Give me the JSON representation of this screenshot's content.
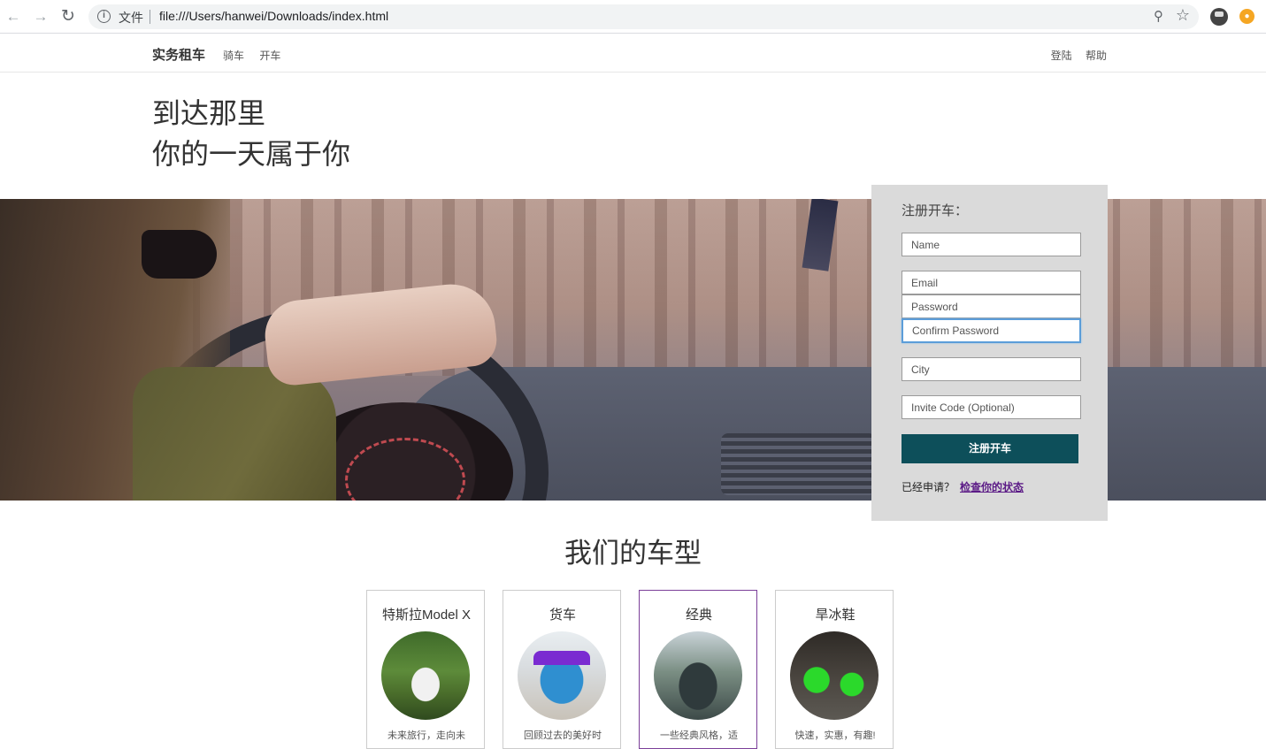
{
  "browser": {
    "scheme_label": "文件",
    "url": "file:///Users/hanwei/Downloads/index.html"
  },
  "site": {
    "brand": "实务租车",
    "nav_left": [
      "骑车",
      "开车"
    ],
    "nav_right": [
      "登陆",
      "帮助"
    ]
  },
  "hero": {
    "line1": "到达那里",
    "line2": "你的一天属于你"
  },
  "signup": {
    "title": "注册开车：",
    "fields": {
      "name": "Name",
      "email": "Email",
      "password": "Password",
      "confirm_password": "Confirm Password",
      "city": "City",
      "invite_code": "Invite Code (Optional)"
    },
    "submit_label": "注册开车",
    "already_text": "已经申请？",
    "status_link": "检查你的状态"
  },
  "models": {
    "title": "我们的车型",
    "cards": [
      {
        "title": "特斯拉Model X",
        "desc": "未来旅行，走向未"
      },
      {
        "title": "货车",
        "desc": "回顾过去的美好时"
      },
      {
        "title": "经典",
        "desc": "一些经典风格，适"
      },
      {
        "title": "旱冰鞋",
        "desc": "快速，实惠，有趣!"
      }
    ]
  },
  "colors": {
    "submit_bg": "#0d4f5a",
    "panel_bg": "#dadada",
    "link": "#5b1a86",
    "active_card_border": "#7b3f99"
  }
}
